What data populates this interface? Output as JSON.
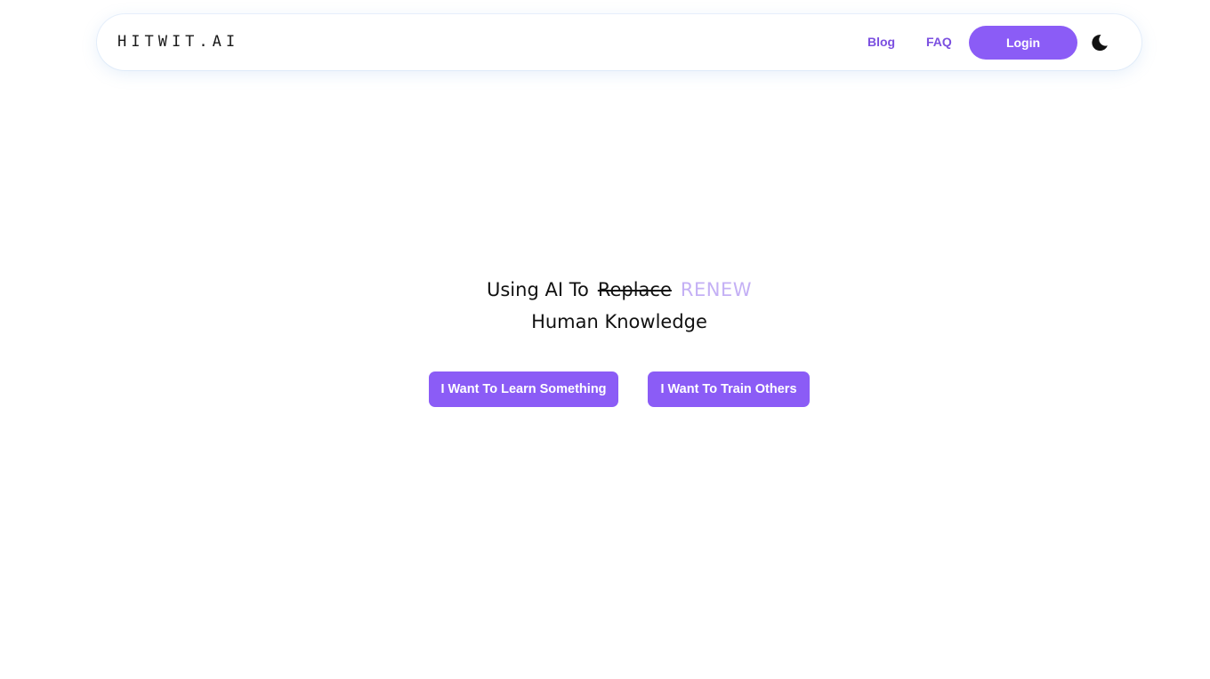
{
  "header": {
    "logo_text": "HITWIT.AI",
    "nav": {
      "blog_label": "Blog",
      "faq_label": "FAQ",
      "login_label": "Login"
    },
    "theme_toggle_icon": "moon-icon"
  },
  "hero": {
    "line1_prefix": "Using AI To",
    "line1_struck": "Replace",
    "line1_highlight": "RENEW",
    "line2": "Human Knowledge"
  },
  "actions": {
    "learn_label": "I Want To Learn Something",
    "train_label": "I Want To Train Others"
  },
  "colors": {
    "accent": "#8b5cf6",
    "link": "#7b4fe0",
    "highlight": "#c4b0f5",
    "text": "#111111"
  }
}
